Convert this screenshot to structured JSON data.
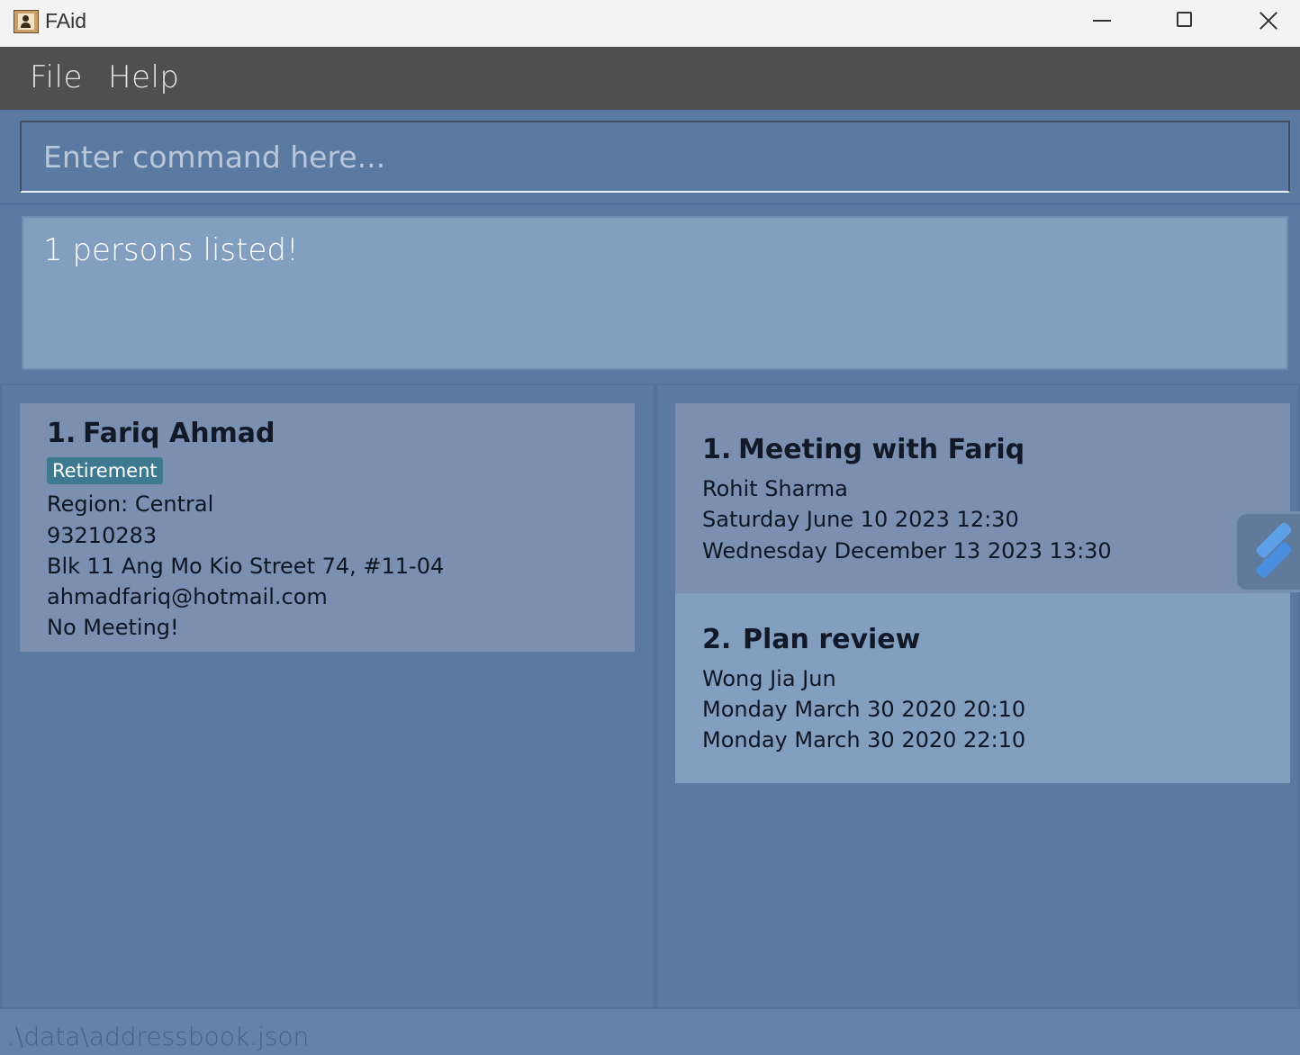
{
  "window": {
    "title": "FAid",
    "icon": "address-book-icon"
  },
  "menu": {
    "file_label": "File",
    "help_label": "Help"
  },
  "command": {
    "placeholder": "Enter command here...",
    "value": ""
  },
  "result": {
    "message": "1 persons listed!"
  },
  "persons": [
    {
      "index": "1.",
      "name": "Fariq Ahmad",
      "tag": "Retirement",
      "region": "Region: Central",
      "phone": "93210283",
      "address": "Blk 11 Ang Mo Kio Street 74, #11-04",
      "email": "ahmadfariq@hotmail.com",
      "meeting_status": "No Meeting!"
    }
  ],
  "meetings": [
    {
      "index": "1.",
      "title": "Meeting with Fariq",
      "attendee": "Rohit Sharma",
      "start": "Saturday June 10 2023 12:30",
      "end": "Wednesday December 13 2023 13:30"
    },
    {
      "index": "2.",
      "title": "Plan review",
      "attendee": "Wong Jia Jun",
      "start": "Monday March 30 2020 20:10",
      "end": "Monday March 30 2020 22:10"
    }
  ],
  "status": {
    "file_path": ".\\data\\addressbook.json"
  },
  "colors": {
    "background": "#5b7aa2",
    "menubar": "#4f4f4f",
    "card_selected": "#7b90b1",
    "card": "#839fc0",
    "tag": "#3d7a91"
  }
}
